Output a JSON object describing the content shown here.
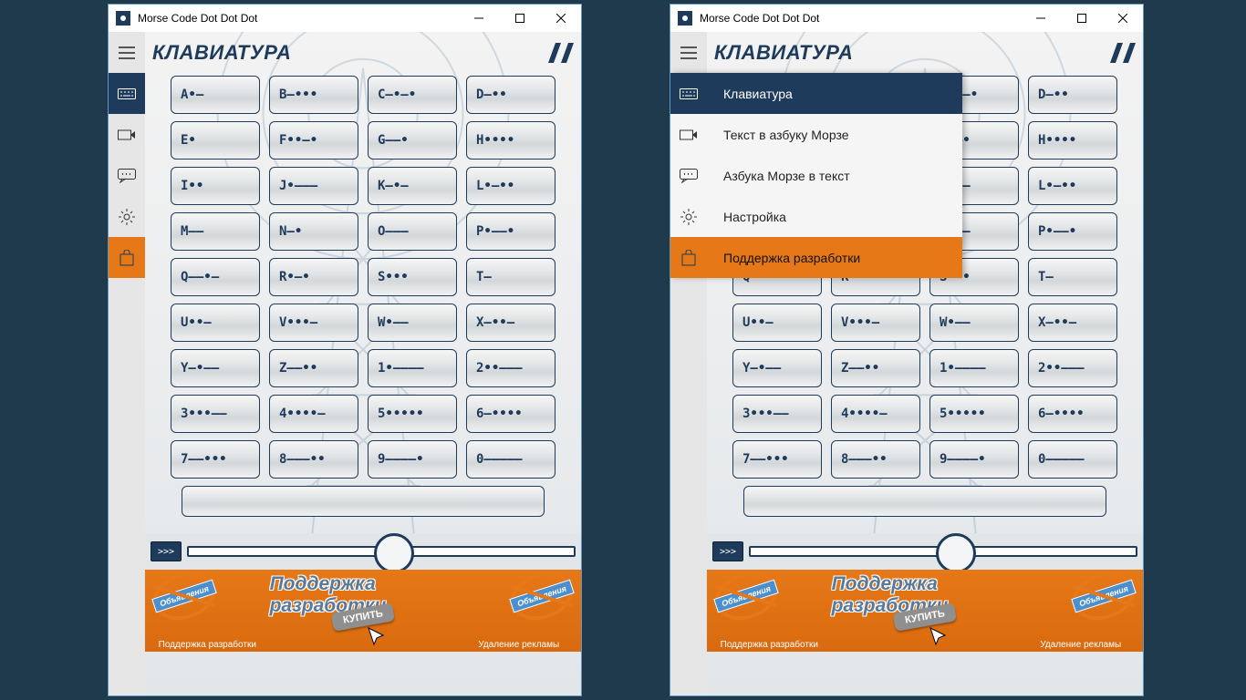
{
  "app_title": "Morse Code Dot Dot Dot",
  "header_title": "КЛАВИАТУРА",
  "nav": {
    "items": [
      {
        "id": "keyboard",
        "label": "Клавиатура",
        "icon": "keyboard-icon"
      },
      {
        "id": "to_morse",
        "label": "Текст в азбуку Морзе",
        "icon": "to-morse-icon"
      },
      {
        "id": "to_text",
        "label": "Азбука Морзе в текст",
        "icon": "chat-icon"
      },
      {
        "id": "settings",
        "label": "Настройка",
        "icon": "gear-icon"
      },
      {
        "id": "support",
        "label": "Поддержка разработки",
        "icon": "bag-icon"
      }
    ],
    "selected": "keyboard",
    "highlight": "support"
  },
  "keys": [
    [
      "A•–",
      "B–•••",
      "C–•–•",
      "D–••"
    ],
    [
      "E•",
      "F••–•",
      "G––•",
      "H••••"
    ],
    [
      "I••",
      "J•–––",
      "K–•–",
      "L•–••"
    ],
    [
      "M––",
      "N–•",
      "O–––",
      "P•––•"
    ],
    [
      "Q––•–",
      "R•–•",
      "S•••",
      "T–"
    ],
    [
      "U••–",
      "V•••–",
      "W•––",
      "X–••–"
    ],
    [
      "Y–•––",
      "Z––••",
      "1•––––",
      "2••–––"
    ],
    [
      "3•••––",
      "4••••–",
      "5•••••",
      "6–••••"
    ],
    [
      "7––•••",
      "8–––••",
      "9––––•",
      "0–––––"
    ]
  ],
  "play_label": ">>>",
  "ad": {
    "headline": "Поддержка разработки",
    "left_caption": "Поддержка разработки",
    "right_caption": "Удаление рекламы",
    "stamp_text": "Объявления",
    "buy_label": "КУПИТЬ"
  },
  "expanded_open_in_win2": true
}
